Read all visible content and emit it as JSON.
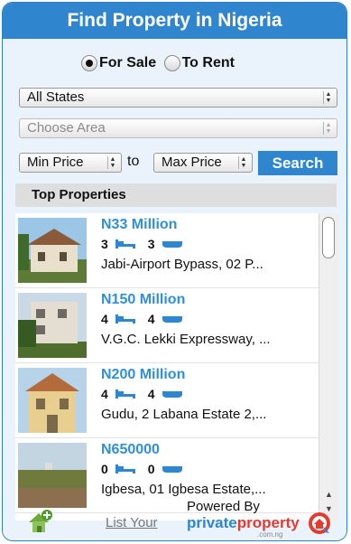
{
  "header": {
    "title": "Find Property in Nigeria"
  },
  "filters": {
    "radios": [
      {
        "label": "For Sale",
        "selected": true
      },
      {
        "label": "To Rent",
        "selected": false
      }
    ],
    "state_select": "All States",
    "area_select": "Choose Area",
    "min_price": "Min Price",
    "to_label": "to",
    "max_price": "Max Price",
    "search_label": "Search"
  },
  "top_properties": {
    "heading": "Top Properties",
    "items": [
      {
        "price": "N33 Million",
        "beds": "3",
        "baths": "3",
        "address": "Jabi-Airport Bypass, 02 P..."
      },
      {
        "price": "N150 Million",
        "beds": "4",
        "baths": "4",
        "address": "V.G.C. Lekki Expressway, ..."
      },
      {
        "price": "N200 Million",
        "beds": "4",
        "baths": "4",
        "address": "Gudu, 2 Labana Estate 2,..."
      },
      {
        "price": "N650000",
        "beds": "0",
        "baths": "0",
        "address": "Igbesa, 01 Igbesa Estate,..."
      }
    ]
  },
  "footer": {
    "list_link": "List Your",
    "powered_by": "Powered By",
    "brand_left": "private",
    "brand_right": "property",
    "brand_sub": ".com.ng"
  },
  "colors": {
    "accent": "#2f86cf",
    "price": "#2f8fd8",
    "brand_red": "#e43b2f"
  },
  "icons": [
    "bed-icon",
    "bath-icon",
    "home-plus-icon",
    "brand-logo-icon"
  ]
}
